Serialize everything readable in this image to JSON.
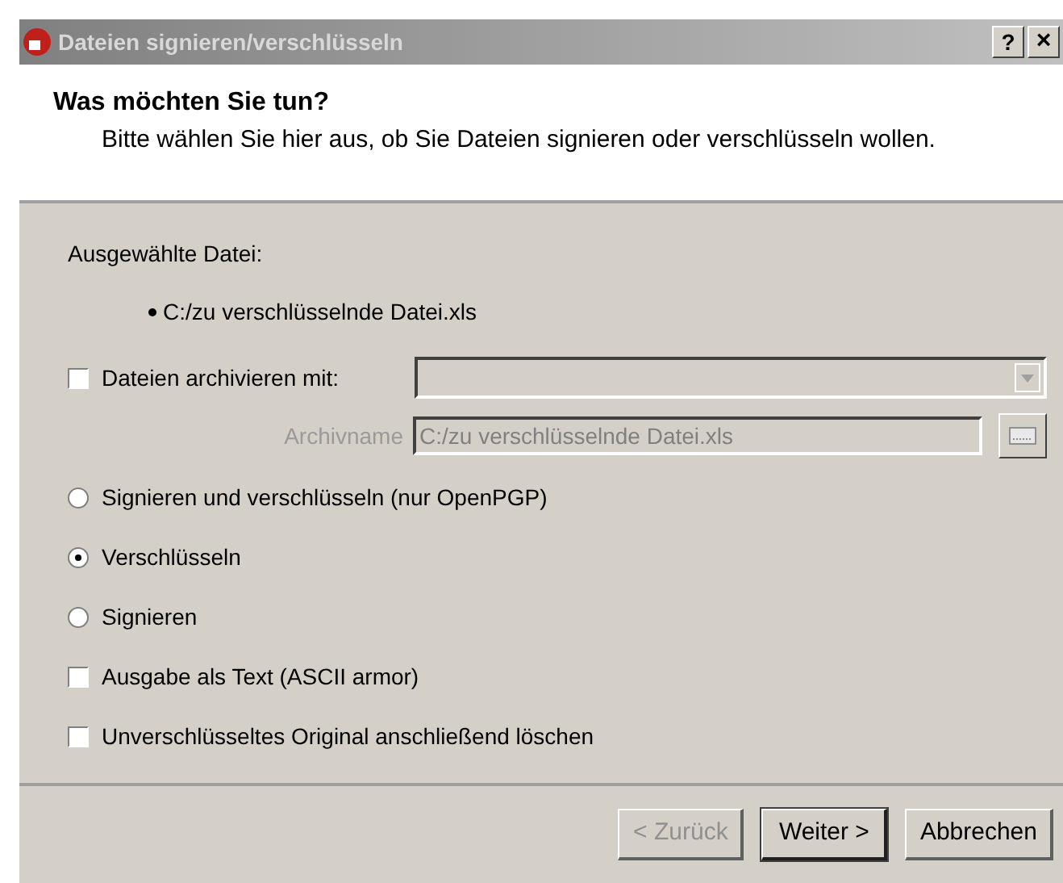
{
  "window": {
    "title": "Dateien signieren/verschlüsseln",
    "help_button": "?",
    "close_button": "×"
  },
  "header": {
    "title": "Was möchten Sie tun?",
    "subtitle": "Bitte wählen Sie hier aus, ob Sie Dateien signieren oder verschlüsseln wollen."
  },
  "selected_file": {
    "label": "Ausgewählte Datei:",
    "files": [
      "C:/zu verschlüsselnde Datei.xls"
    ]
  },
  "archive": {
    "label": "Dateien archivieren mit:",
    "checked": false,
    "archive_name_label": "Archivname",
    "archive_name": "C:/zu verschlüsselnde Datei.xls",
    "disabled": true
  },
  "options": [
    {
      "kind": "radio",
      "label": "Signieren und verschlüsseln (nur OpenPGP)",
      "selected": false
    },
    {
      "kind": "radio",
      "label": "Verschlüsseln",
      "selected": true
    },
    {
      "kind": "radio",
      "label": "Signieren",
      "selected": false
    },
    {
      "kind": "checkbox",
      "label": "Ausgabe als Text (ASCII armor)",
      "checked": false
    },
    {
      "kind": "checkbox",
      "label": "Unverschlüsseltes Original anschließend löschen",
      "checked": false
    }
  ],
  "buttons": [
    {
      "label": "< Zurück",
      "disabled": true,
      "default": false
    },
    {
      "label": "Weiter >",
      "disabled": false,
      "default": true
    },
    {
      "label": "Abbrechen",
      "disabled": false,
      "default": false
    }
  ]
}
